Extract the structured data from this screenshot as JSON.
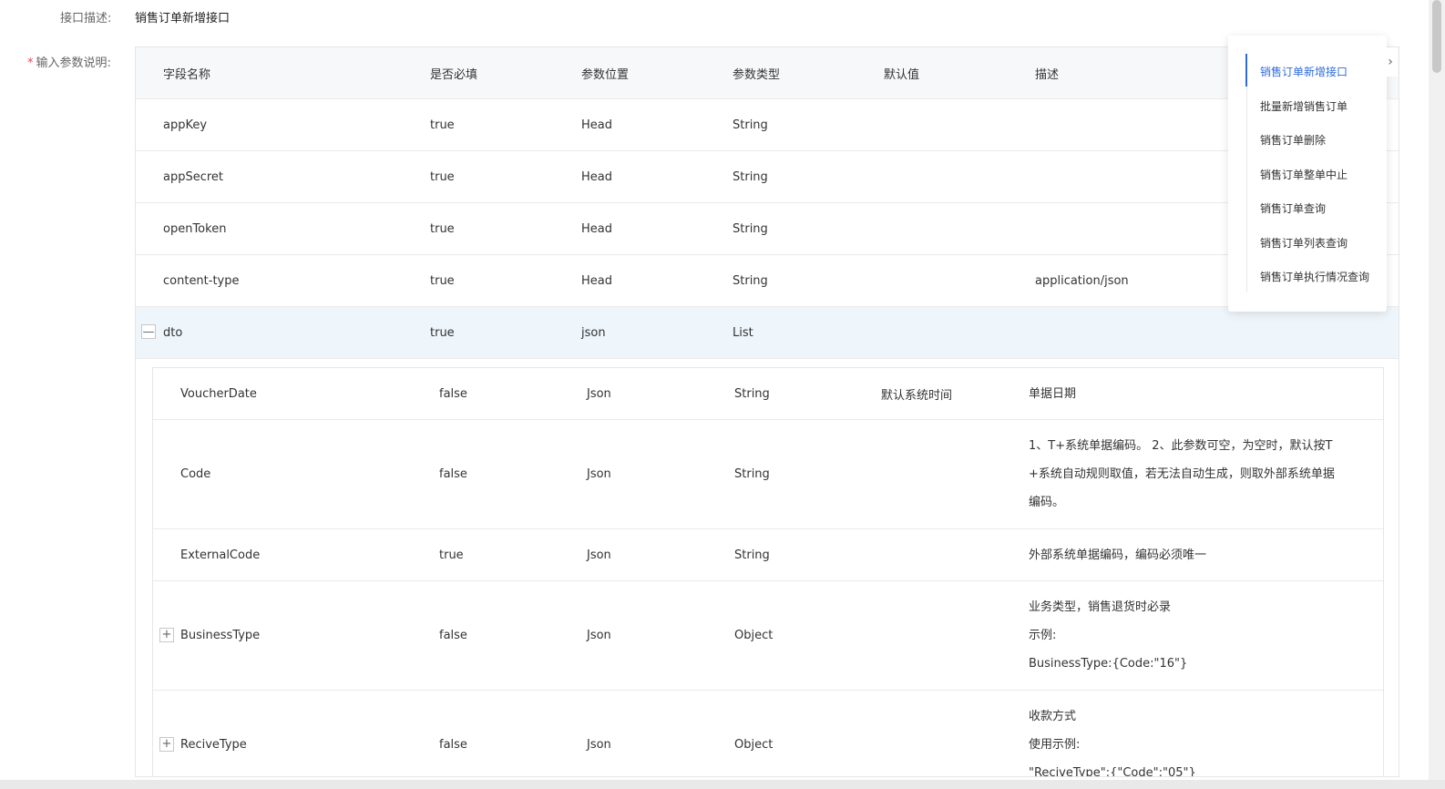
{
  "interface_desc": {
    "label": "接口描述:",
    "value": "销售订单新增接口"
  },
  "param_section": {
    "required_mark": "*",
    "label": "输入参数说明:"
  },
  "table": {
    "headers": [
      "字段名称",
      "是否必填",
      "参数位置",
      "参数类型",
      "默认值",
      "描述"
    ],
    "rows": [
      {
        "name": "appKey",
        "required": "true",
        "position": "Head",
        "type": "String",
        "default": "",
        "desc": ""
      },
      {
        "name": "appSecret",
        "required": "true",
        "position": "Head",
        "type": "String",
        "default": "",
        "desc": ""
      },
      {
        "name": "openToken",
        "required": "true",
        "position": "Head",
        "type": "String",
        "default": "",
        "desc": ""
      },
      {
        "name": "content-type",
        "required": "true",
        "position": "Head",
        "type": "String",
        "default": "",
        "desc": "application/json"
      },
      {
        "name": "dto",
        "required": "true",
        "position": "json",
        "type": "List",
        "default": "",
        "desc": "",
        "toggle": "—"
      }
    ]
  },
  "subtable": {
    "rows": [
      {
        "name": "VoucherDate",
        "required": "false",
        "position": "Json",
        "type": "String",
        "default": "默认系统时间",
        "desc_lines": [
          "单据日期"
        ]
      },
      {
        "name": "Code",
        "required": "false",
        "position": "Json",
        "type": "String",
        "default": "",
        "desc_lines": [
          "1、T+系统单据编码。 2、此参数可空，为空时，默认按T",
          "+系统自动规则取值，若无法自动生成，则取外部系统单据",
          "编码。"
        ]
      },
      {
        "name": "ExternalCode",
        "required": "true",
        "position": "Json",
        "type": "String",
        "default": "",
        "desc_lines": [
          "外部系统单据编码，编码必须唯一"
        ]
      },
      {
        "name": "BusinessType",
        "required": "false",
        "position": "Json",
        "type": "Object",
        "default": "",
        "desc_lines": [
          "业务类型，销售退货时必录",
          "示例:",
          "BusinessType:{Code:\"16\"}"
        ],
        "toggle": "+"
      },
      {
        "name": "ReciveType",
        "required": "false",
        "position": "Json",
        "type": "Object",
        "default": "",
        "desc_lines": [
          "收款方式",
          "使用示例:",
          "\"ReciveType\":{\"Code\":\"05\"}"
        ],
        "toggle": "+"
      }
    ]
  },
  "toc": {
    "items": [
      "销售订单新增接口",
      "批量新增销售订单",
      "销售订单删除",
      "销售订单整单中止",
      "销售订单查询",
      "销售订单列表查询",
      "销售订单执行情况查询"
    ],
    "active_index": 0,
    "collapse_glyph": "›"
  },
  "colors": {
    "accent": "#2f6bdc",
    "required_star": "#e5454f",
    "expanded_row_bg": "#eef5fb",
    "header_bg": "#f7f8fa"
  }
}
